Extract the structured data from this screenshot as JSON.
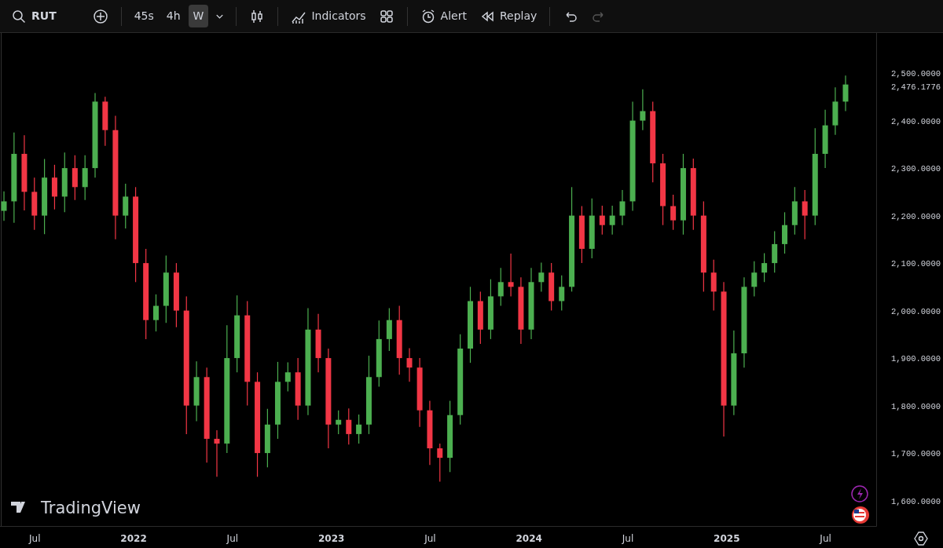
{
  "toolbar": {
    "symbol": "RUT",
    "intervals": [
      {
        "label": "45s",
        "selected": false
      },
      {
        "label": "4h",
        "selected": false
      },
      {
        "label": "W",
        "selected": true
      }
    ],
    "indicators": "Indicators",
    "alert": "Alert",
    "replay": "Replay",
    "redo_disabled": true
  },
  "chart": {
    "logo": "TradingView",
    "price_label": "2,476.1776",
    "chart_data": {
      "type": "candlestick",
      "xlim": [
        2021.324,
        2025.756
      ],
      "ylim": [
        1546.4,
        2584.5
      ],
      "yticks": [
        {
          "value": 1600,
          "label": "1,600.0000"
        },
        {
          "value": 1700,
          "label": "1,700.0000"
        },
        {
          "value": 1800,
          "label": "1,800.0000"
        },
        {
          "value": 1900,
          "label": "1,900.0000"
        },
        {
          "value": 2000,
          "label": "2,000.0000"
        },
        {
          "value": 2100,
          "label": "2,100.0000"
        },
        {
          "value": 2200,
          "label": "2,200.0000"
        },
        {
          "value": 2300,
          "label": "2,300.0000"
        },
        {
          "value": 2400,
          "label": "2,400.0000"
        },
        {
          "value": 2500,
          "label": "2,500.0000"
        }
      ],
      "xticks": [
        {
          "value": 2021.5,
          "label": "Jul"
        },
        {
          "value": 2022,
          "label": "2022"
        },
        {
          "value": 2022.5,
          "label": "Jul"
        },
        {
          "value": 2023,
          "label": "2023"
        },
        {
          "value": 2023.5,
          "label": "Jul"
        },
        {
          "value": 2024,
          "label": "2024"
        },
        {
          "value": 2024.5,
          "label": "Jul"
        },
        {
          "value": 2025,
          "label": "2025"
        },
        {
          "value": 2025.5,
          "label": "Jul"
        }
      ],
      "x": [
        2021.344,
        2021.395,
        2021.447,
        2021.498,
        2021.549,
        2021.6,
        2021.651,
        2021.703,
        2021.754,
        2021.805,
        2021.856,
        2021.908,
        2021.959,
        2022.01,
        2022.062,
        2022.113,
        2022.164,
        2022.216,
        2022.267,
        2022.318,
        2022.37,
        2022.421,
        2022.472,
        2022.523,
        2022.575,
        2022.626,
        2022.677,
        2022.729,
        2022.78,
        2022.831,
        2022.882,
        2022.934,
        2022.985,
        2023.036,
        2023.088,
        2023.139,
        2023.19,
        2023.241,
        2023.293,
        2023.344,
        2023.395,
        2023.447,
        2023.498,
        2023.549,
        2023.6,
        2023.652,
        2023.703,
        2023.754,
        2023.806,
        2023.857,
        2023.908,
        2023.959,
        2024.011,
        2024.062,
        2024.113,
        2024.165,
        2024.216,
        2024.267,
        2024.318,
        2024.37,
        2024.421,
        2024.472,
        2024.524,
        2024.575,
        2024.626,
        2024.677,
        2024.729,
        2024.78,
        2024.831,
        2024.883,
        2024.934,
        2024.985,
        2025.036,
        2025.088,
        2025.139,
        2025.19,
        2025.242,
        2025.293,
        2025.344,
        2025.395,
        2025.447,
        2025.498,
        2025.549,
        2025.601
      ],
      "ohlc": [
        [
          2210,
          2251,
          2189,
          2230
        ],
        [
          2230,
          2375,
          2185,
          2330
        ],
        [
          2330,
          2369,
          2211,
          2250
        ],
        [
          2250,
          2280,
          2170,
          2200
        ],
        [
          2200,
          2319,
          2161,
          2280
        ],
        [
          2280,
          2307,
          2213,
          2240
        ],
        [
          2240,
          2333,
          2207,
          2300
        ],
        [
          2300,
          2327,
          2233,
          2260
        ],
        [
          2260,
          2327,
          2233,
          2300
        ],
        [
          2300,
          2458,
          2280,
          2440
        ],
        [
          2440,
          2450,
          2347,
          2380
        ],
        [
          2380,
          2410,
          2150,
          2200
        ],
        [
          2200,
          2267,
          2173,
          2240
        ],
        [
          2240,
          2260,
          2060,
          2100
        ],
        [
          2100,
          2130,
          1940,
          1980
        ],
        [
          1980,
          2034,
          1956,
          2010
        ],
        [
          2010,
          2116,
          1974,
          2080
        ],
        [
          2080,
          2100,
          1965,
          2000
        ],
        [
          2000,
          2030,
          1740,
          1800
        ],
        [
          1800,
          1893,
          1767,
          1860
        ],
        [
          1860,
          1880,
          1680,
          1730
        ],
        [
          1730,
          1748,
          1650,
          1720
        ],
        [
          1720,
          1969,
          1700,
          1900
        ],
        [
          1900,
          2032,
          1870,
          1990
        ],
        [
          1990,
          2020,
          1800,
          1850
        ],
        [
          1850,
          1870,
          1650,
          1700
        ],
        [
          1700,
          1793,
          1670,
          1760
        ],
        [
          1760,
          1892,
          1730,
          1850
        ],
        [
          1850,
          1891,
          1830,
          1870
        ],
        [
          1870,
          1900,
          1770,
          1800
        ],
        [
          1800,
          2005,
          1780,
          1960
        ],
        [
          1960,
          1993,
          1870,
          1900
        ],
        [
          1900,
          1920,
          1710,
          1760
        ],
        [
          1760,
          1790,
          1740,
          1770
        ],
        [
          1770,
          1794,
          1718,
          1740
        ],
        [
          1740,
          1781,
          1720,
          1760
        ],
        [
          1760,
          1905,
          1740,
          1860
        ],
        [
          1860,
          1979,
          1840,
          1940
        ],
        [
          1940,
          2005,
          1915,
          1980
        ],
        [
          1980,
          2010,
          1865,
          1900
        ],
        [
          1900,
          1921,
          1850,
          1880
        ],
        [
          1880,
          1900,
          1755,
          1790
        ],
        [
          1790,
          1810,
          1675,
          1710
        ],
        [
          1710,
          1720,
          1640,
          1690
        ],
        [
          1690,
          1810,
          1660,
          1780
        ],
        [
          1780,
          1950,
          1760,
          1920
        ],
        [
          1920,
          2050,
          1890,
          2020
        ],
        [
          2020,
          2040,
          1930,
          1960
        ],
        [
          1960,
          2066,
          1940,
          2030
        ],
        [
          2030,
          2090,
          2010,
          2060
        ],
        [
          2060,
          2120,
          2030,
          2050
        ],
        [
          2050,
          2070,
          1930,
          1960
        ],
        [
          1960,
          2090,
          1940,
          2060
        ],
        [
          2060,
          2101,
          2040,
          2080
        ],
        [
          2080,
          2100,
          2000,
          2020
        ],
        [
          2020,
          2074,
          2000,
          2050
        ],
        [
          2050,
          2260,
          2040,
          2200
        ],
        [
          2200,
          2220,
          2100,
          2130
        ],
        [
          2130,
          2236,
          2110,
          2200
        ],
        [
          2200,
          2221,
          2160,
          2180
        ],
        [
          2180,
          2221,
          2160,
          2200
        ],
        [
          2200,
          2254,
          2180,
          2230
        ],
        [
          2230,
          2440,
          2210,
          2400
        ],
        [
          2400,
          2466,
          2380,
          2420
        ],
        [
          2420,
          2440,
          2270,
          2310
        ],
        [
          2310,
          2330,
          2180,
          2220
        ],
        [
          2220,
          2244,
          2170,
          2190
        ],
        [
          2190,
          2330,
          2160,
          2300
        ],
        [
          2300,
          2320,
          2170,
          2200
        ],
        [
          2200,
          2230,
          2040,
          2080
        ],
        [
          2080,
          2107,
          2000,
          2040
        ],
        [
          2040,
          2060,
          1735,
          1800
        ],
        [
          1800,
          1958,
          1780,
          1910
        ],
        [
          1910,
          2070,
          1880,
          2050
        ],
        [
          2050,
          2104,
          2030,
          2080
        ],
        [
          2080,
          2121,
          2060,
          2100
        ],
        [
          2100,
          2167,
          2080,
          2140
        ],
        [
          2140,
          2207,
          2120,
          2180
        ],
        [
          2180,
          2260,
          2160,
          2230
        ],
        [
          2230,
          2254,
          2150,
          2200
        ],
        [
          2200,
          2384,
          2180,
          2330
        ],
        [
          2330,
          2423,
          2300,
          2390
        ],
        [
          2390,
          2470,
          2370,
          2440
        ],
        [
          2440,
          2495,
          2420,
          2476
        ]
      ]
    }
  }
}
